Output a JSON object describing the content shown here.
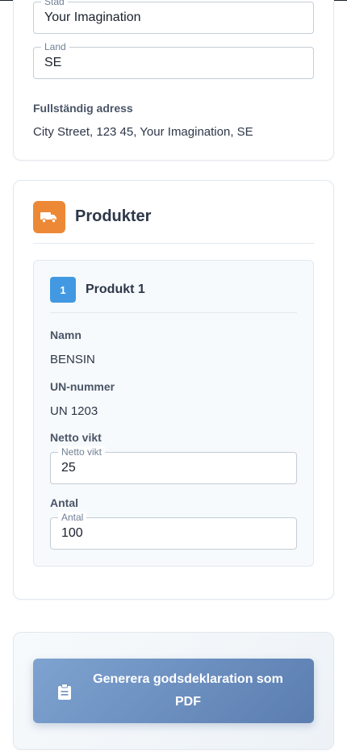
{
  "address": {
    "city": {
      "label": "Stad",
      "value": "Your Imagination"
    },
    "country": {
      "label": "Land",
      "value": "SE"
    },
    "full_address_label": "Fullständig adress",
    "full_address_value": "City Street, 123 45, Your Imagination, SE"
  },
  "products": {
    "section_title": "Produkter",
    "section_icon": "truck-icon",
    "accent_color": "#ed8936",
    "items": [
      {
        "index": "1",
        "title": "Produkt 1",
        "name_label": "Namn",
        "name_value": "BENSIN",
        "un_label": "UN-nummer",
        "un_value": "UN 1203",
        "net_weight_heading": "Netto vikt",
        "net_weight_field_label": "Netto vikt",
        "net_weight_value": "25",
        "quantity_heading": "Antal",
        "quantity_field_label": "Antal",
        "quantity_value": "100"
      }
    ]
  },
  "actions": {
    "generate_pdf_label": "Generera godsdeklaration som PDF",
    "generate_pdf_icon": "clipboard-icon",
    "button_color": "#6a8ec2"
  }
}
